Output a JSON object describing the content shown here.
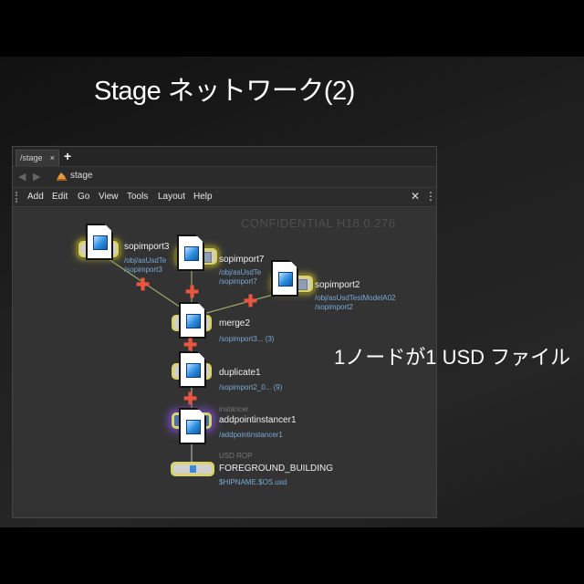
{
  "slide": {
    "title": "Stage ネットワーク(2)",
    "caption": "1ノードが1 USD ファイル"
  },
  "window": {
    "tab": {
      "label": "/stage",
      "close": "×",
      "add": "+"
    },
    "path": {
      "back": "◀",
      "forward": "▶",
      "label": "stage"
    },
    "menu": [
      "Add",
      "Edit",
      "Go",
      "View",
      "Tools",
      "Layout",
      "Help"
    ],
    "tools": {
      "wrench": "✕",
      "list": "⋮≡"
    },
    "watermark": "CONFIDENTIAL H18.0.276"
  },
  "nodes": {
    "sopimport3": {
      "name": "sopimport3",
      "path": "/obj/asUsdTe\n/sopimport3"
    },
    "sopimport7": {
      "name": "sopimport7",
      "path": "/obj/asUsdTe\n/sopimport7"
    },
    "sopimport2": {
      "name": "sopimport2",
      "path": "/obj/asUsdTestModelA02\n/sopimport2"
    },
    "merge2": {
      "name": "merge2",
      "path": "/sopimport3... (3)"
    },
    "duplicate1": {
      "name": "duplicate1",
      "path": "/sopimport2_0... (9)"
    },
    "addpointinstancer1": {
      "label": "instancer",
      "name": "addpointinstancer1",
      "path": "/addpointinstancer1"
    },
    "usd_rop": {
      "label": "USD ROP",
      "name": "FOREGROUND_BUILDING",
      "path": "$HIPNAME.$OS.usd"
    }
  },
  "colors": {
    "accent": "#d9d36a",
    "plus": "#e9553f",
    "path": "#79a9d6"
  }
}
